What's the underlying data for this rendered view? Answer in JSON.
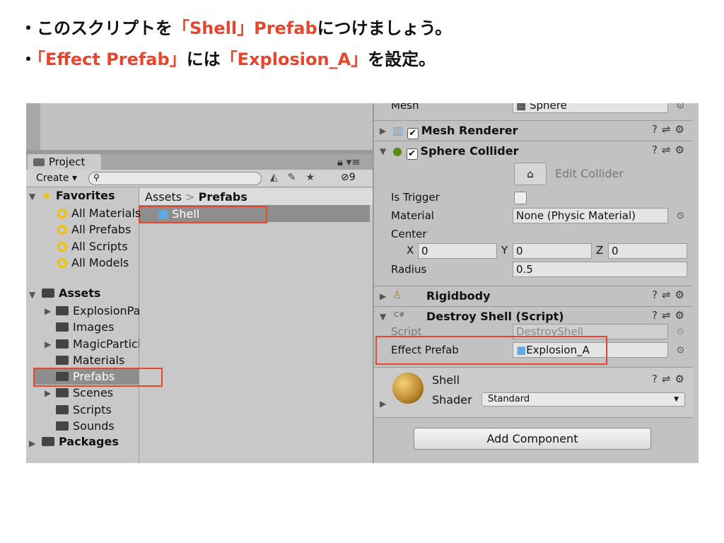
{
  "slide": {
    "bullet1": {
      "pre": "・このスクリプトを",
      "red1": "「Shell」Prefab",
      "post": "につけましょう。"
    },
    "bullet2": {
      "pre": "・",
      "red1": "「Effect Prefab」",
      "mid": "には",
      "red2": "「Explosion_A」",
      "post": "を設定。"
    }
  },
  "project": {
    "tab": "Project",
    "create": "Create ▾",
    "hidden_count": "9",
    "breadcrumb": {
      "root": "Assets",
      "sep": ">",
      "current": "Prefabs"
    },
    "favorites": {
      "label": "Favorites",
      "items": [
        "All Materials",
        "All Prefabs",
        "All Scripts",
        "All Models"
      ]
    },
    "assets": {
      "label": "Assets",
      "items": [
        "ExplosionPa",
        "Images",
        "MagicParticl",
        "Materials",
        "Prefabs",
        "Scenes",
        "Scripts",
        "Sounds"
      ]
    },
    "packages": "Packages",
    "selected_folder": "Prefabs",
    "files": [
      "Shell"
    ]
  },
  "inspector": {
    "mesh": {
      "label": "Mesh",
      "value": "Sphere"
    },
    "mesh_renderer": "Mesh Renderer",
    "sphere_collider": {
      "title": "Sphere Collider",
      "edit": "Edit Collider",
      "is_trigger": "Is Trigger",
      "is_trigger_checked": false,
      "material_label": "Material",
      "material": "None (Physic Material)",
      "center": "Center",
      "x": "0",
      "y": "0",
      "z": "0",
      "radius_label": "Radius",
      "radius": "0.5"
    },
    "rigidbody": "Rigidbody",
    "destroy_shell": {
      "title": "Destroy Shell (Script)",
      "script_label": "Script",
      "script": "DestroyShell",
      "effect_label": "Effect Prefab",
      "effect": "Explosion_A"
    },
    "material": {
      "name": "Shell",
      "shader_label": "Shader",
      "shader": "Standard"
    },
    "add_component": "Add Component"
  },
  "colors": {
    "accent": "#e8452c"
  }
}
